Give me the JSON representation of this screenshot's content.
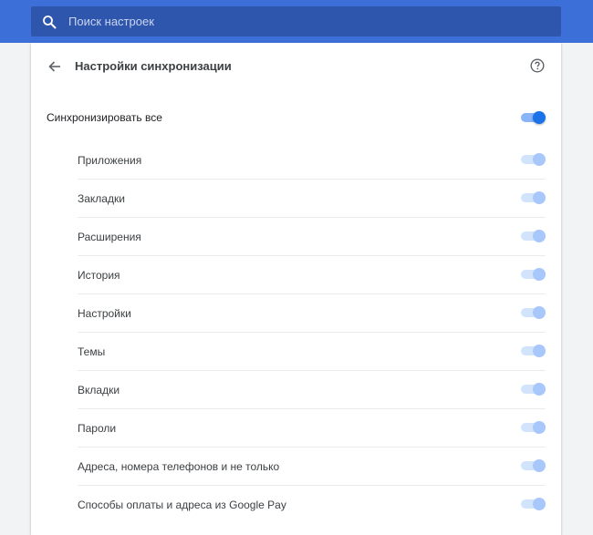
{
  "search": {
    "placeholder": "Поиск настроек"
  },
  "header": {
    "title": "Настройки синхронизации"
  },
  "master": {
    "label": "Синхронизировать все",
    "enabled": true
  },
  "colors": {
    "accent": "#1a73e8",
    "topbar": "#3d6fd8"
  },
  "items": [
    {
      "label": "Приложения"
    },
    {
      "label": "Закладки"
    },
    {
      "label": "Расширения"
    },
    {
      "label": "История"
    },
    {
      "label": "Настройки"
    },
    {
      "label": "Темы"
    },
    {
      "label": "Вкладки"
    },
    {
      "label": "Пароли"
    },
    {
      "label": "Адреса, номера телефонов и не только"
    },
    {
      "label": "Способы оплаты и адреса из Google Pay"
    }
  ]
}
